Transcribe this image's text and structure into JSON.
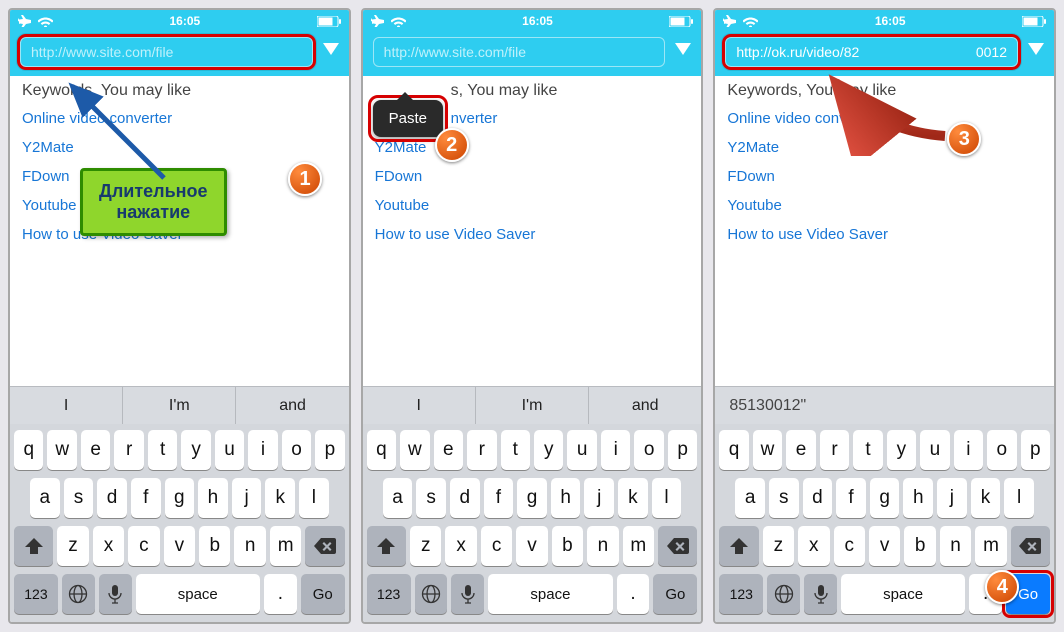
{
  "status": {
    "time": "16:05"
  },
  "placeholder": "http://www.site.com/file",
  "filled_url_a": "http://ok.ru/video/82",
  "filled_url_b": "0012",
  "keywords_title": "Keywords, You may like",
  "keywords_title_clipped": "s, You may like",
  "links": [
    "Online video converter",
    "Y2Mate",
    "FDown",
    "Youtube",
    "How to use Video Saver"
  ],
  "links_clipped_first": "nverter",
  "predict": {
    "a": "I",
    "b": "I'm",
    "c": "and"
  },
  "predict_single": "85130012\"",
  "kbd": {
    "r1": [
      "q",
      "w",
      "e",
      "r",
      "t",
      "y",
      "u",
      "i",
      "o",
      "p"
    ],
    "r2": [
      "a",
      "s",
      "d",
      "f",
      "g",
      "h",
      "j",
      "k",
      "l"
    ],
    "r3": [
      "z",
      "x",
      "c",
      "v",
      "b",
      "n",
      "m"
    ],
    "k123": "123",
    "space": "space",
    "dot": ".",
    "go": "Go"
  },
  "paste_label": "Paste",
  "callout_line1": "Длительное",
  "callout_line2": "нажатие",
  "badges": {
    "b1": "1",
    "b2": "2",
    "b3": "3",
    "b4": "4"
  }
}
